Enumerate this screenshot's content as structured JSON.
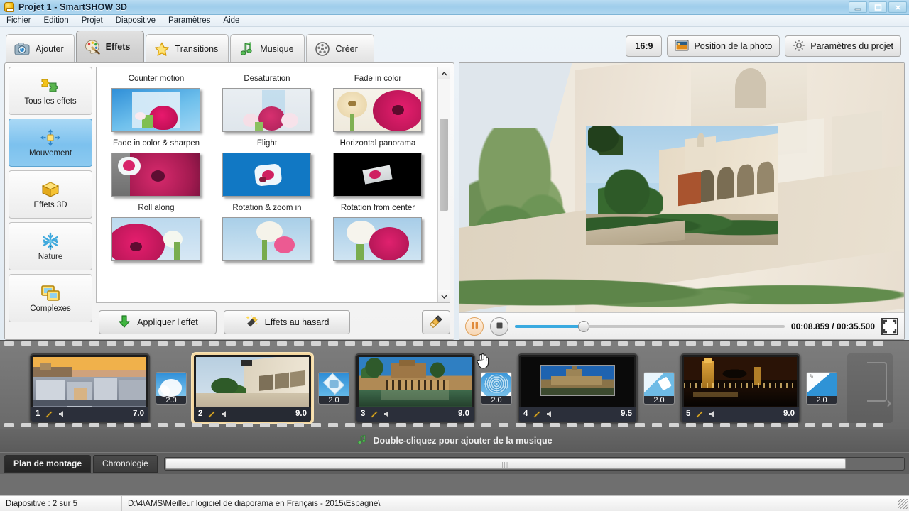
{
  "window": {
    "title": "Projet 1 - SmartSHOW 3D",
    "app_icon": "app-logo-icon",
    "minimize": "—",
    "maximize": "▫",
    "close": "✕"
  },
  "menubar": {
    "items": [
      {
        "label": "Fichier"
      },
      {
        "label": "Edition"
      },
      {
        "label": "Projet"
      },
      {
        "label": "Diapositive"
      },
      {
        "label": "Paramètres"
      },
      {
        "label": "Aide"
      }
    ]
  },
  "tabs": [
    {
      "label": "Ajouter",
      "icon": "camera-icon",
      "active": false
    },
    {
      "label": "Effets",
      "icon": "palette-icon",
      "active": true
    },
    {
      "label": "Transitions",
      "icon": "star-icon",
      "active": false
    },
    {
      "label": "Musique",
      "icon": "music-note-icon",
      "active": false
    },
    {
      "label": "Créer",
      "icon": "film-reel-icon",
      "active": false
    }
  ],
  "categories": [
    {
      "label": "Tous les effets",
      "icon": "puzzle-icon",
      "active": false
    },
    {
      "label": "Mouvement",
      "icon": "move-arrows-icon",
      "active": true
    },
    {
      "label": "Effets 3D",
      "icon": "cube-icon",
      "active": false
    },
    {
      "label": "Nature",
      "icon": "snowflake-icon",
      "active": false
    },
    {
      "label": "Complexes",
      "icon": "layers-icon",
      "active": false
    }
  ],
  "effects": [
    {
      "label": "Counter motion"
    },
    {
      "label": "Desaturation"
    },
    {
      "label": "Fade in color"
    },
    {
      "label": "Fade in color & sharpen"
    },
    {
      "label": "Flight"
    },
    {
      "label": "Horizontal panorama"
    },
    {
      "label": "Roll along"
    },
    {
      "label": "Rotation & zoom in"
    },
    {
      "label": "Rotation from center"
    }
  ],
  "effect_buttons": {
    "apply": "Appliquer l'effet",
    "apply_icon": "down-arrow-icon",
    "random": "Effets au hasard",
    "random_icon": "magic-wand-icon",
    "clear_icon": "paintbrush-icon"
  },
  "preview_toolbar": {
    "ratio": "16:9",
    "photo_position": "Position de la photo",
    "photo_position_icon": "image-icon",
    "project_settings": "Paramètres du projet",
    "project_settings_icon": "gear-icon"
  },
  "player": {
    "pause_icon": "pause-icon",
    "stop_icon": "stop-icon",
    "fullscreen_icon": "fullscreen-icon",
    "time": "00:08.859 / 00:35.500",
    "current_time": "00:08.859",
    "total_time": "00:35.500",
    "progress_percent": 25
  },
  "timeline": {
    "slides": [
      {
        "number": "1",
        "duration": "7.0",
        "selected": false,
        "edit_icon": "pencil-icon",
        "sound_icon": "speaker-icon",
        "thumb": "madrid-gran-via-sunset"
      },
      {
        "number": "2",
        "duration": "9.0",
        "selected": true,
        "edit_icon": "pencil-icon",
        "sound_icon": "speaker-icon",
        "thumb": "seville-alcazar-facade"
      },
      {
        "number": "3",
        "duration": "9.0",
        "selected": false,
        "edit_icon": "pencil-icon",
        "sound_icon": "speaker-icon",
        "thumb": "alhambra-partal-palace"
      },
      {
        "number": "4",
        "duration": "9.5",
        "selected": false,
        "edit_icon": "pencil-icon",
        "sound_icon": "speaker-icon",
        "thumb": "bellver-castle-framed"
      },
      {
        "number": "5",
        "duration": "9.0",
        "selected": false,
        "edit_icon": "pencil-icon",
        "sound_icon": "speaker-icon",
        "thumb": "torre-del-oro-night"
      }
    ],
    "transitions": [
      {
        "duration": "2.0",
        "icon": "cloud-wipe-transition"
      },
      {
        "duration": "2.0",
        "icon": "diamond-move-transition"
      },
      {
        "duration": "2.0",
        "icon": "spiral-transition"
      },
      {
        "duration": "2.0",
        "icon": "sweep-transition"
      },
      {
        "duration": "2.0",
        "icon": "diagonal-wipe-transition"
      }
    ]
  },
  "music_strip": {
    "label": "Double-cliquez pour ajouter de la musique",
    "icon": "music-note-icon"
  },
  "bottom_tabs": [
    {
      "label": "Plan de montage",
      "active": true
    },
    {
      "label": "Chronologie",
      "active": false
    }
  ],
  "statusbar": {
    "slide_info": "Diapositive : 2 sur 5",
    "path": "D:\\4\\AMS\\Meilleur logiciel de diaporama en Français - 2015\\Espagne\\"
  },
  "colors": {
    "accent_blue": "#3aaae0",
    "selected_category": "#7cc1ee",
    "selected_slide_border": "#f5d8a0",
    "titlebar": "#9fcdeb",
    "timeline_bg": "#6f6f6f"
  }
}
